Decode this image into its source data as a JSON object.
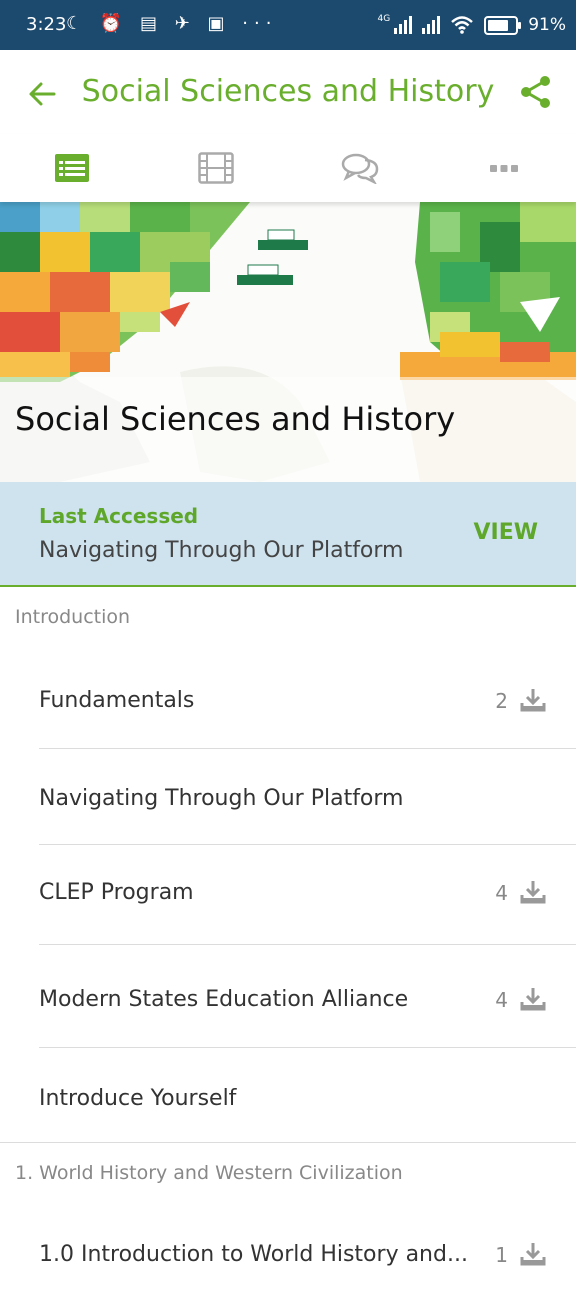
{
  "status_bar": {
    "time": "3:23",
    "left_icons": [
      "moon-icon",
      "alarm-icon",
      "news-icon",
      "telegram-icon",
      "gmail-icon",
      "more-dots-icon"
    ],
    "network_label": "4G",
    "battery_percent": "91",
    "battery_level": 0.91
  },
  "app_bar": {
    "title": "Social Sciences and History",
    "accent_color": "#6aae2e"
  },
  "tabs": [
    {
      "name": "lessons",
      "icon": "list-icon",
      "active": true
    },
    {
      "name": "videos",
      "icon": "film-icon",
      "active": false
    },
    {
      "name": "discussions",
      "icon": "chat-bubbles-icon",
      "active": false
    },
    {
      "name": "more",
      "icon": "more-dots-icon",
      "active": false
    }
  ],
  "banner": {
    "title": "Social Sciences and History"
  },
  "last_accessed": {
    "label": "Last Accessed",
    "value": "Navigating Through Our Platform",
    "action": "VIEW"
  },
  "sections": [
    {
      "header": "Introduction",
      "lessons": [
        {
          "title": "Fundamentals",
          "count": "2"
        },
        {
          "title": "Navigating Through Our Platform",
          "count": ""
        },
        {
          "title": "CLEP Program",
          "count": "4"
        },
        {
          "title": "Modern States Education Alliance",
          "count": "4"
        },
        {
          "title": "Introduce Yourself",
          "count": ""
        }
      ]
    },
    {
      "header": "1. World History and Western Civilization",
      "lessons": [
        {
          "title": "1.0 Introduction to World History and...",
          "count": "1"
        }
      ]
    }
  ]
}
